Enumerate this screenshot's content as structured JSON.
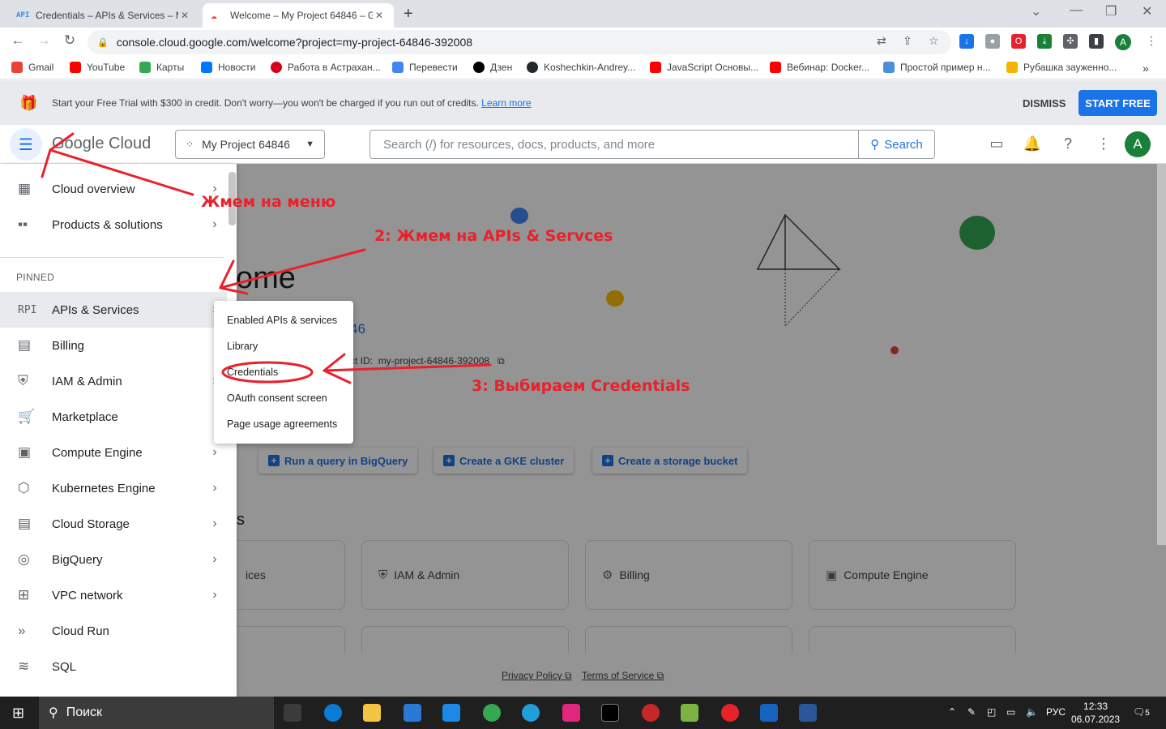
{
  "browser": {
    "tabs": [
      {
        "favicon": "API",
        "title": "Credentials – APIs & Services – M"
      },
      {
        "favicon": "cloud",
        "title": "Welcome – My Project 64846 – G"
      }
    ],
    "url": "console.cloud.google.com/welcome?project=my-project-64846-392008",
    "profile_initial": "A",
    "bookmarks": [
      {
        "label": "Gmail",
        "color": "#ea4335"
      },
      {
        "label": "YouTube",
        "color": "#ff0000"
      },
      {
        "label": "Карты",
        "color": "#34a853"
      },
      {
        "label": "Новости",
        "color": "#0077ff"
      },
      {
        "label": "Работа в Астрахан...",
        "color": "#d6001c"
      },
      {
        "label": "Перевести",
        "color": "#4285f4"
      },
      {
        "label": "Дзен",
        "color": "#000000"
      },
      {
        "label": "Koshechkin-Andrey...",
        "color": "#24292e"
      },
      {
        "label": "JavaScript Основы...",
        "color": "#ff0000"
      },
      {
        "label": "Вебинар: Docker...",
        "color": "#ff0000"
      },
      {
        "label": "Простой пример н...",
        "color": "#4a90d9"
      },
      {
        "label": "Рубашка зауженно...",
        "color": "#f4b400"
      }
    ]
  },
  "promo": {
    "message": "Start your Free Trial with $300 in credit. Don't worry—you won't be charged if you run out of credits.",
    "learn_more": "Learn more",
    "dismiss": "DISMISS",
    "start_free": "START FREE"
  },
  "header": {
    "logo": "Google Cloud",
    "project": "My Project 64846",
    "search_placeholder": "Search (/) for resources, docs, products, and more",
    "search_button": "Search",
    "avatar_initial": "A"
  },
  "sidenav": {
    "top_items": [
      {
        "label": "Cloud overview",
        "icon": "dashboard-icon"
      },
      {
        "label": "Products & solutions",
        "icon": "grid-icon"
      }
    ],
    "pinned_header": "PINNED",
    "pinned_items": [
      {
        "label": "APIs & Services",
        "icon": "api-icon",
        "icon_glyph": "RPI"
      },
      {
        "label": "Billing",
        "icon": "billing-icon",
        "icon_glyph": "▤"
      },
      {
        "label": "IAM & Admin",
        "icon": "shield-icon",
        "icon_glyph": "⛨"
      },
      {
        "label": "Marketplace",
        "icon": "cart-icon",
        "icon_glyph": "🛒"
      },
      {
        "label": "Compute Engine",
        "icon": "chip-icon",
        "icon_glyph": "▣"
      },
      {
        "label": "Kubernetes Engine",
        "icon": "kubernetes-icon",
        "icon_glyph": "⬡"
      },
      {
        "label": "Cloud Storage",
        "icon": "storage-icon",
        "icon_glyph": "▤"
      },
      {
        "label": "BigQuery",
        "icon": "bigquery-icon",
        "icon_glyph": "◎"
      },
      {
        "label": "VPC network",
        "icon": "network-icon",
        "icon_glyph": "⊞"
      },
      {
        "label": "Cloud Run",
        "icon": "cloud-run-icon",
        "icon_glyph": "»"
      },
      {
        "label": "SQL",
        "icon": "sql-icon",
        "icon_glyph": "≋"
      }
    ]
  },
  "submenu": {
    "items": [
      "Enabled APIs & services",
      "Library",
      "Credentials",
      "OAuth consent screen",
      "Page usage agreements"
    ]
  },
  "main": {
    "welcome": "come",
    "project_number": "46",
    "project_id_label": "ct ID:",
    "project_id": "my-project-64846-392008",
    "quick_actions": [
      "Run a query in BigQuery",
      "Create a GKE cluster",
      "Create a storage bucket"
    ],
    "section_fragment": "s",
    "cards": [
      "ices",
      "IAM & Admin",
      "Billing",
      "Compute Engine"
    ]
  },
  "footer": {
    "privacy": "Privacy Policy",
    "terms": "Terms of Service"
  },
  "annotations": {
    "step1": "Жмем на меню",
    "step2": "2: Жмем на APIs & Servces",
    "step3": "3: Выбираем Credentials",
    "color": "#e8222b"
  },
  "taskbar": {
    "search": "Поиск",
    "lang": "РУС",
    "time": "12:33",
    "date": "06.07.2023",
    "notifications": "5"
  }
}
